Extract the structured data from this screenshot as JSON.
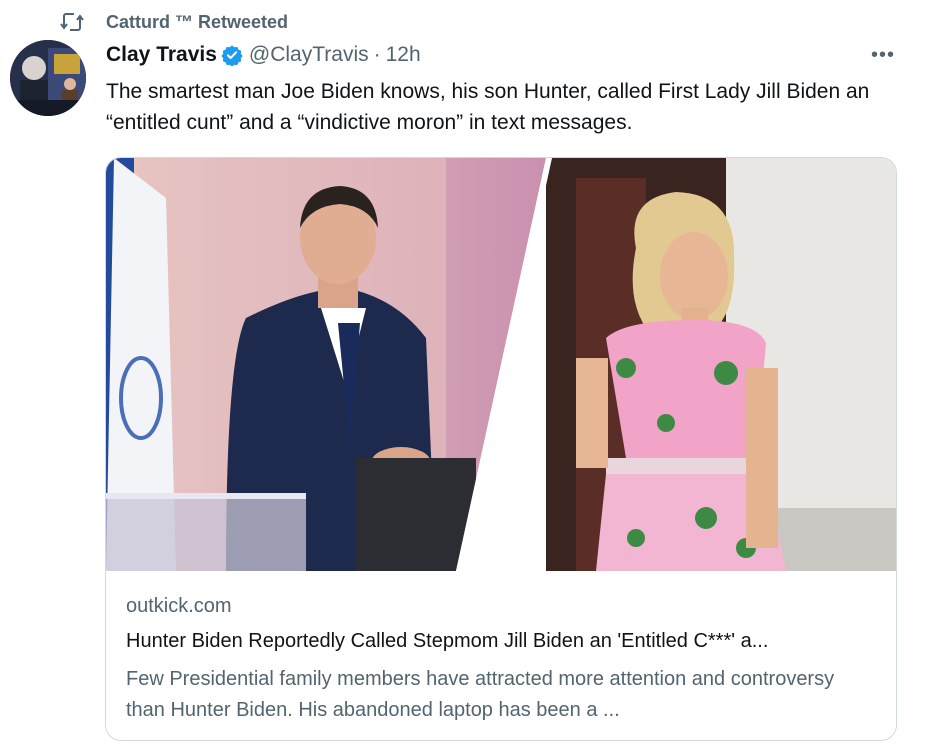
{
  "social_context": {
    "text": "Catturd ™ Retweeted"
  },
  "author": {
    "display_name": "Clay Travis",
    "handle": "@ClayTravis",
    "separator": "·",
    "time": "12h"
  },
  "more_label": "•••",
  "tweet": {
    "text": "The smartest man Joe Biden knows, his son Hunter, called First Lady Jill Biden an “entitled cunt” and a “vindictive moron” in text messages."
  },
  "card": {
    "domain": "outkick.com",
    "title": "Hunter Biden Reportedly Called Stepmom Jill Biden an 'Entitled C***' a...",
    "description": "Few Presidential family members have attracted more attention and controversy than Hunter Biden. His abandoned laptop has been a ..."
  },
  "colors": {
    "verified": "#1d9bf0",
    "secondary_text": "#536471",
    "border": "#cfd9de"
  },
  "icons": {
    "retweet": "retweet-icon",
    "verified": "verified-badge-icon",
    "more": "more-icon"
  }
}
